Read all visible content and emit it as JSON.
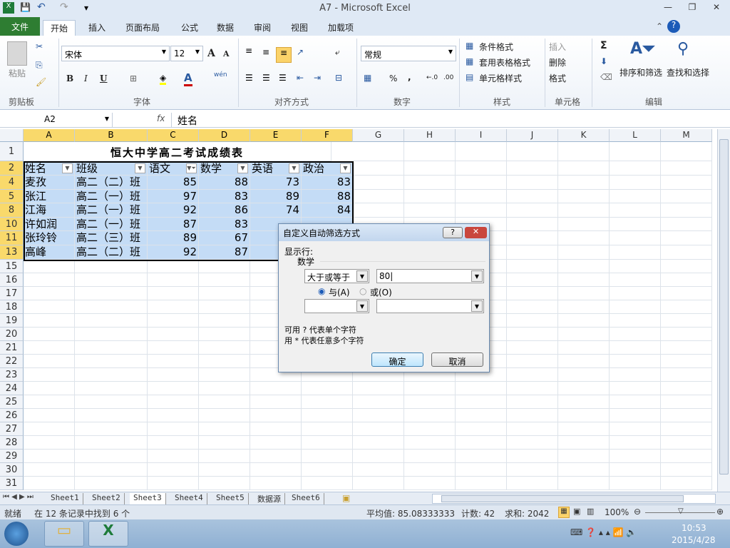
{
  "window": {
    "title": "A7 - Microsoft Excel",
    "minimize": "—",
    "restore": "❐",
    "close": "✕"
  },
  "qat": {
    "save": "💾",
    "undo": "↶",
    "redo": "↷",
    "customize": "▾"
  },
  "tabs": [
    "文件",
    "开始",
    "插入",
    "页面布局",
    "公式",
    "数据",
    "审阅",
    "视图",
    "加载项"
  ],
  "ribbon": {
    "clipboard": {
      "paste": "粘贴",
      "group": "剪贴板"
    },
    "font": {
      "name": "宋体",
      "size": "12",
      "bold": "B",
      "italic": "I",
      "underline": "U",
      "grow": "A",
      "shrink": "A",
      "phonetic": "wén",
      "group": "字体"
    },
    "align": {
      "group": "对齐方式"
    },
    "number": {
      "format": "常规",
      "percent": "%",
      "comma": ",",
      "inc": "←.0",
      "dec": ".00",
      "group": "数字"
    },
    "styles": {
      "cond": "条件格式",
      "table": "套用表格格式",
      "cell": "单元格样式",
      "group": "样式"
    },
    "cells": {
      "insert": "插入",
      "delete": "删除",
      "format": "格式",
      "group": "单元格"
    },
    "edit": {
      "sum": "Σ",
      "sort": "排序和筛选",
      "find": "查找和选择",
      "group": "编辑"
    }
  },
  "formula_bar": {
    "name_box": "A2",
    "fx": "fx",
    "value": "姓名"
  },
  "columns": [
    "A",
    "B",
    "C",
    "D",
    "E",
    "F",
    "G",
    "H",
    "I",
    "J",
    "K",
    "L",
    "M"
  ],
  "sheet": {
    "title": "恒大中学高二考试成绩表",
    "headers": [
      "姓名",
      "班级",
      "语文",
      "数学",
      "英语",
      "政治"
    ],
    "rows": [
      {
        "row": "4",
        "cells": [
          "麦孜",
          "高二（二）班",
          "85",
          "88",
          "73",
          "83"
        ]
      },
      {
        "row": "5",
        "cells": [
          "张江",
          "高二（一）班",
          "97",
          "83",
          "89",
          "88"
        ]
      },
      {
        "row": "8",
        "cells": [
          "江海",
          "高二（一）班",
          "92",
          "86",
          "74",
          "84"
        ]
      },
      {
        "row": "10",
        "cells": [
          "许如润",
          "高二（一）班",
          "87",
          "83",
          "",
          ""
        ]
      },
      {
        "row": "11",
        "cells": [
          "张玲铃",
          "高二（三）班",
          "89",
          "67",
          "",
          ""
        ]
      },
      {
        "row": "13",
        "cells": [
          "高峰",
          "高二（二）班",
          "92",
          "87",
          "",
          ""
        ]
      }
    ],
    "empty_rows": [
      "15",
      "16",
      "17",
      "18",
      "19",
      "20",
      "21",
      "22",
      "23",
      "24",
      "25",
      "26",
      "27",
      "28",
      "29",
      "30",
      "31"
    ]
  },
  "sheet_tabs": [
    "Sheet1",
    "Sheet2",
    "Sheet3",
    "Sheet4",
    "Sheet5",
    "数据源",
    "Sheet6"
  ],
  "active_sheet": "Sheet3",
  "status": {
    "ready": "就绪",
    "found": "在 12 条记录中找到 6 个",
    "avg": "平均值: 85.08333333",
    "count": "计数: 42",
    "sum": "求和: 2042",
    "zoom": "100%"
  },
  "dialog": {
    "title": "自定义自动筛选方式",
    "help": "?",
    "close": "✕",
    "show_rows": "显示行:",
    "field": "数学",
    "op1": "大于或等于",
    "val1": "80",
    "and": "与(A)",
    "or": "或(O)",
    "op2": "",
    "val2": "",
    "hint1": "可用 ? 代表单个字符",
    "hint2": "用 * 代表任意多个字符",
    "ok": "确定",
    "cancel": "取消"
  },
  "taskbar": {
    "time": "10:53",
    "date": "2015/4/28"
  }
}
